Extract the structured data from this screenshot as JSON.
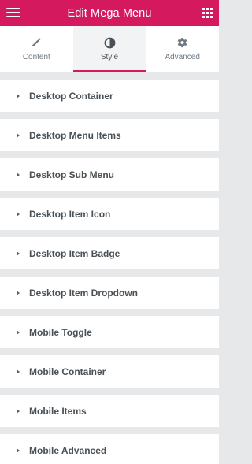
{
  "header": {
    "title": "Edit Mega Menu",
    "menu_icon": "hamburger-icon",
    "apps_icon": "grid-icon",
    "background_color": "#d5195f"
  },
  "tabs": [
    {
      "label": "Content",
      "icon": "pencil-icon",
      "active": false
    },
    {
      "label": "Style",
      "icon": "contrast-icon",
      "active": true
    },
    {
      "label": "Advanced",
      "icon": "gear-icon",
      "active": false
    }
  ],
  "sections": [
    {
      "label": "Desktop Container"
    },
    {
      "label": "Desktop Menu Items"
    },
    {
      "label": "Desktop Sub Menu"
    },
    {
      "label": "Desktop Item Icon"
    },
    {
      "label": "Desktop Item Badge"
    },
    {
      "label": "Desktop Item Dropdown"
    },
    {
      "label": "Mobile Toggle"
    },
    {
      "label": "Mobile Container"
    },
    {
      "label": "Mobile Items"
    },
    {
      "label": "Mobile Advanced"
    }
  ]
}
